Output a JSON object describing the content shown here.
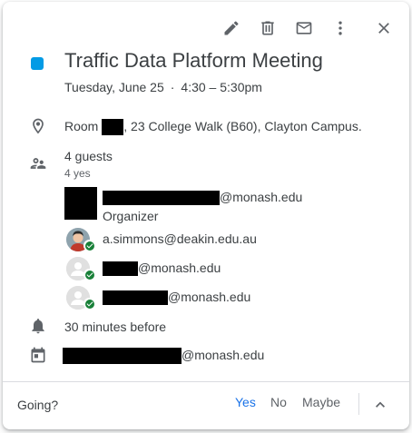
{
  "event": {
    "color": "#039be5",
    "title": "Traffic Data Platform Meeting",
    "date": "Tuesday, June 25",
    "separator": "·",
    "time": "4:30 – 5:30pm"
  },
  "toolbar": {
    "icons": [
      "edit-icon",
      "delete-icon",
      "email-icon",
      "more-options-icon",
      "close-icon"
    ]
  },
  "location": {
    "prefix": "Room",
    "suffix": ", 23 College Walk (B60), Clayton Campus."
  },
  "guests": {
    "count_label": "4 guests",
    "rsvp_summary": "4 yes",
    "list": [
      {
        "email_suffix": "@monash.edu",
        "role": "Organizer"
      },
      {
        "email": "a.simmons@deakin.edu.au"
      },
      {
        "email_suffix": "@monash.edu"
      },
      {
        "email_suffix": "@monash.edu"
      }
    ]
  },
  "reminder": {
    "text": "30 minutes before"
  },
  "calendar": {
    "email_suffix": "@monash.edu"
  },
  "footer": {
    "going_label": "Going?",
    "yes_label": "Yes",
    "no_label": "No",
    "maybe_label": "Maybe",
    "accent_color": "#1a73e8"
  }
}
